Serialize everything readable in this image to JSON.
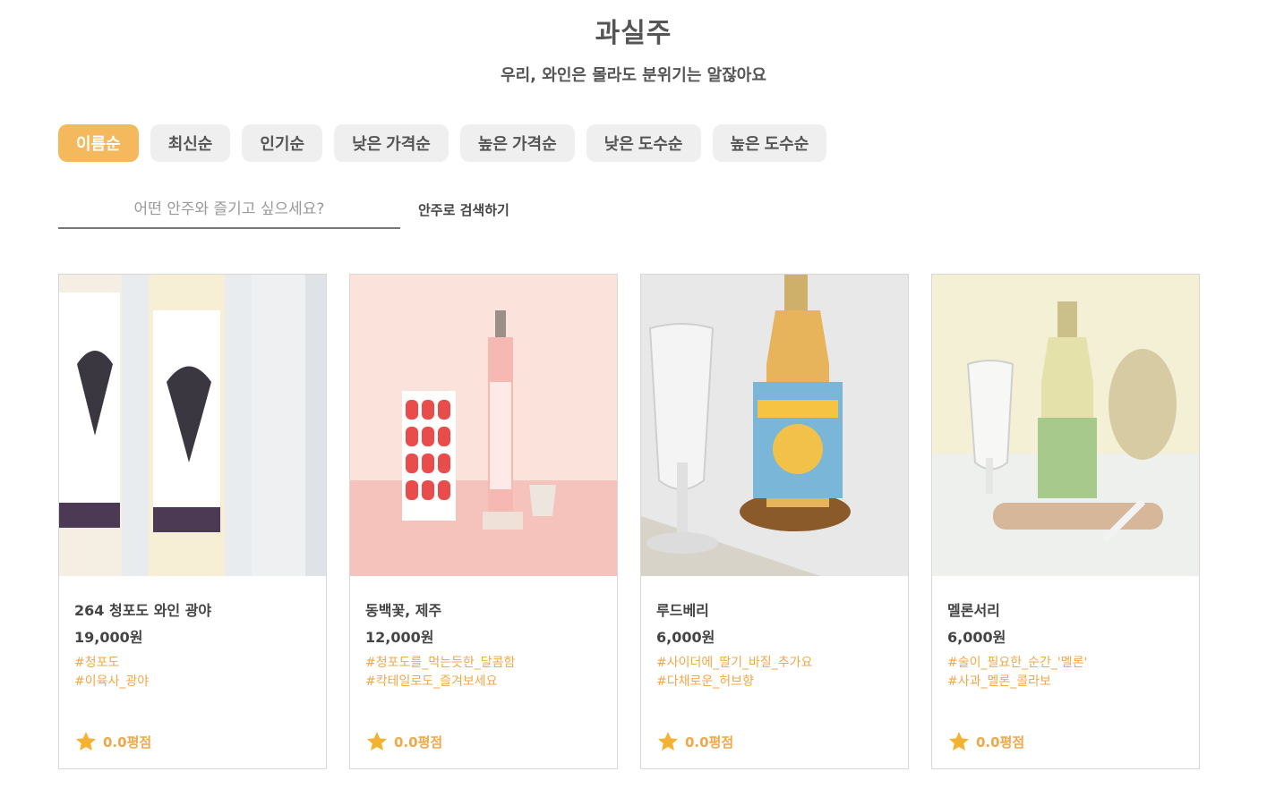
{
  "header": {
    "title": "과실주",
    "subtitle": "우리, 와인은 몰라도 분위기는 알잖아요"
  },
  "sort_options": [
    "이름순",
    "최신순",
    "인기순",
    "낮은 가격순",
    "높은 가격순",
    "낮은 도수순",
    "높은 도수순"
  ],
  "active_sort": "이름순",
  "search": {
    "placeholder": "어떤 안주와 즐기고 싶으세요?",
    "button_label": "안주로 검색하기"
  },
  "products": [
    {
      "name": "264 청포도 와인 광야",
      "price": "19,000원",
      "tags": [
        "#청포도",
        "#이육사_광야"
      ],
      "rating": "0.0평점",
      "image_colors": {
        "bg": "#e9ecef",
        "accent": "#f1e3b8"
      }
    },
    {
      "name": "동백꽃, 제주",
      "price": "12,000원",
      "tags": [
        "#청포도를_먹는듯한_달콤함",
        "#칵테일로도_즐겨보세요"
      ],
      "rating": "0.0평점",
      "image_colors": {
        "bg": "#f8d9d3",
        "accent": "#f2a9a9"
      }
    },
    {
      "name": "루드베리",
      "price": "6,000원",
      "tags": [
        "#사이더에_딸기_바질_추가요",
        "#다채로운_허브향"
      ],
      "rating": "0.0평점",
      "image_colors": {
        "bg": "#e7e7e7",
        "accent": "#e9b863"
      }
    },
    {
      "name": "멜론서리",
      "price": "6,000원",
      "tags": [
        "#술이_필요한_순간_'멜론'",
        "#사과_멜론_콜라보"
      ],
      "rating": "0.0평점",
      "image_colors": {
        "bg": "#f4f0d6",
        "accent": "#e4e3b4"
      }
    }
  ],
  "colors": {
    "accent": "#f4b95d",
    "tag": "#f0a84a",
    "star": "#f4b233"
  }
}
